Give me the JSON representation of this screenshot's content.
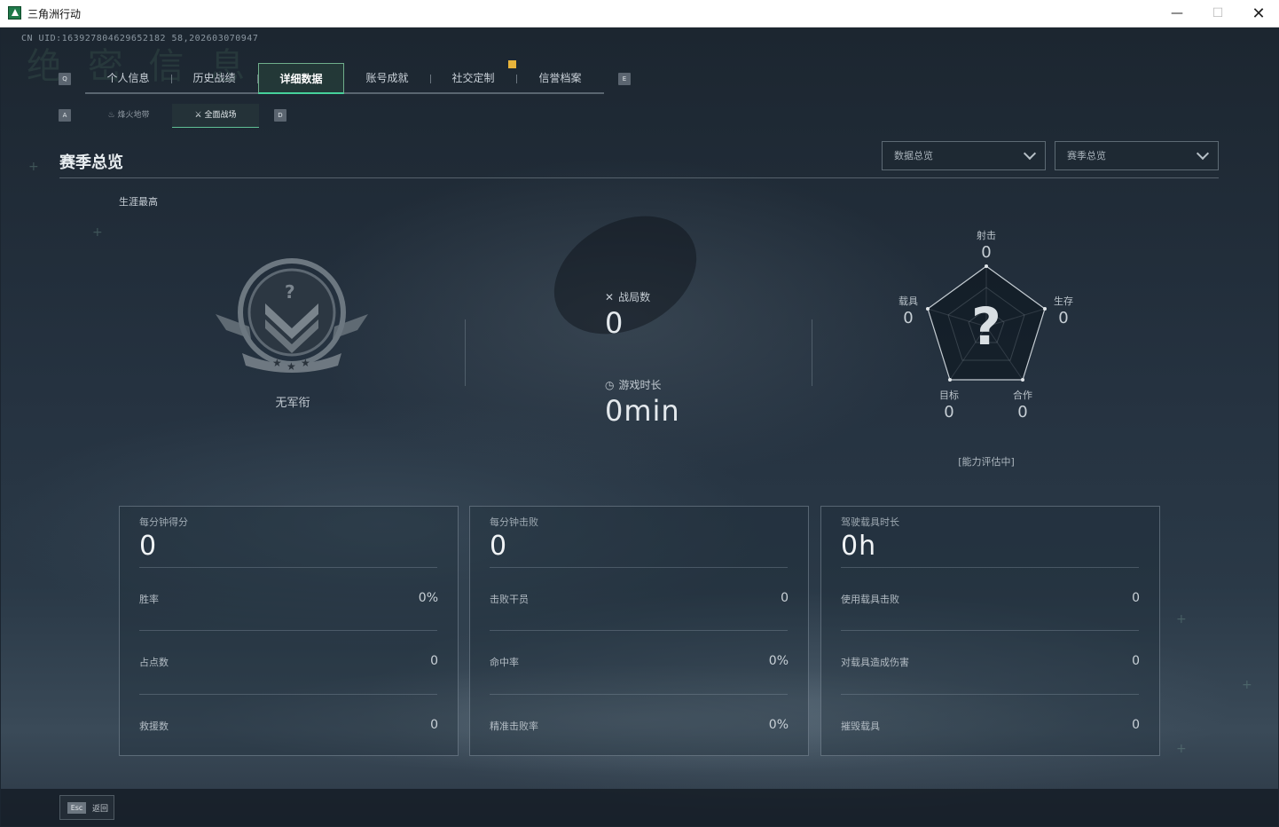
{
  "window": {
    "title": "三角洲行动",
    "minimize": "—",
    "maximize": "☐",
    "close": "✕"
  },
  "uid": "CN UID:163927804629652182 58,202603070947",
  "ghost_heading": "绝 密 信 息",
  "nav": {
    "left_key": "Q",
    "right_key": "E",
    "tabs": [
      {
        "label": "个人信息"
      },
      {
        "label": "历史战绩"
      },
      {
        "label": "详细数据",
        "active": true
      },
      {
        "label": "账号成就"
      },
      {
        "label": "社交定制"
      },
      {
        "label": "信誉档案"
      }
    ],
    "notification_color": "#e7b33b"
  },
  "subnav": {
    "left_key": "A",
    "right_key": "D",
    "tabs": [
      {
        "label": "烽火地带",
        "icon": "flame-icon"
      },
      {
        "label": "全面战场",
        "icon": "battlefield-icon",
        "active": true
      }
    ]
  },
  "section": {
    "title": "赛季总览",
    "dropdown_data": "数据总览",
    "dropdown_season": "赛季总览"
  },
  "career": {
    "label": "生涯最高",
    "rank_name": "无军衔",
    "rank_icon": "rank-emblem-unknown"
  },
  "center_stats": {
    "matches_label": "战局数",
    "matches_value": "0",
    "playtime_label": "游戏时长",
    "playtime_value": "0min"
  },
  "radar": {
    "center_symbol": "?",
    "axes": [
      {
        "label": "射击",
        "value": "0"
      },
      {
        "label": "生存",
        "value": "0"
      },
      {
        "label": "合作",
        "value": "0"
      },
      {
        "label": "目标",
        "value": "0"
      },
      {
        "label": "载具",
        "value": "0"
      }
    ],
    "note": "[能力评估中]"
  },
  "cards": [
    {
      "title": "每分钟得分",
      "main": "0",
      "rows": [
        {
          "label": "胜率",
          "value": "0%"
        },
        {
          "label": "占点数",
          "value": "0"
        },
        {
          "label": "救援数",
          "value": "0"
        }
      ]
    },
    {
      "title": "每分钟击败",
      "main": "0",
      "rows": [
        {
          "label": "击败干员",
          "value": "0"
        },
        {
          "label": "命中率",
          "value": "0%"
        },
        {
          "label": "精准击败率",
          "value": "0%"
        }
      ]
    },
    {
      "title": "驾驶载具时长",
      "main": "0h",
      "rows": [
        {
          "label": "使用载具击败",
          "value": "0"
        },
        {
          "label": "对载具造成伤害",
          "value": "0"
        },
        {
          "label": "摧毁载具",
          "value": "0"
        }
      ]
    }
  ],
  "footer": {
    "esc_key": "Esc",
    "back_label": "返回"
  },
  "colors": {
    "accent": "#46d19a",
    "text": "#e8edf0",
    "notify": "#e7b33b"
  }
}
